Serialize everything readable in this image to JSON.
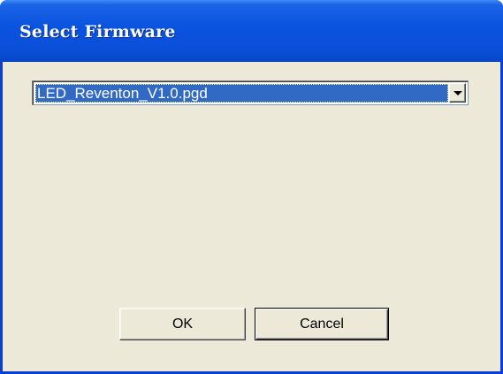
{
  "window": {
    "title": "Select Firmware"
  },
  "firmware_select": {
    "selected_value": "LED_Reventon_V1.0.pgd",
    "dropdown_icon": "chevron-down-icon"
  },
  "buttons": {
    "ok_label": "OK",
    "cancel_label": "Cancel"
  },
  "colors": {
    "titlebar": "#0a54e0",
    "selection": "#316ac5",
    "dialog_bg": "#ece9d8"
  }
}
